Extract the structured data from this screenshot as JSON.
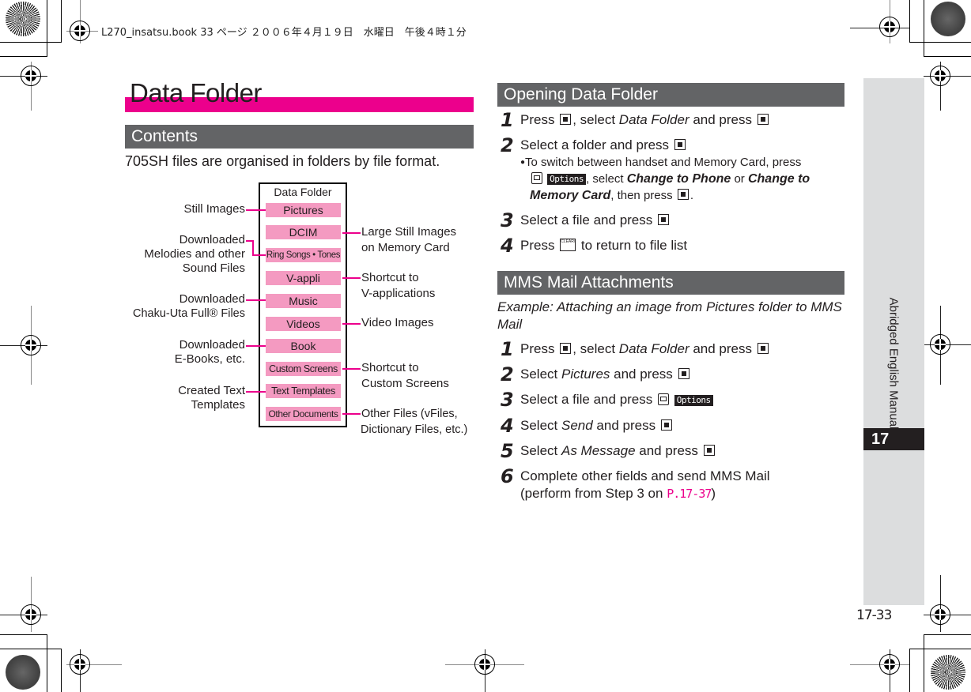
{
  "print_header": "L270_insatsu.book  33 ページ  ２００６年４月１９日　水曜日　午後４時１分",
  "page_title": "Data Folder",
  "contents": {
    "heading": "Contents",
    "intro": "705SH files are organised in folders by file format.",
    "diagram": {
      "box_title": "Data Folder",
      "folders": [
        "Pictures",
        "DCIM",
        "Ring Songs • Tones",
        "V-appli",
        "Music",
        "Videos",
        "Book",
        "Custom Screens",
        "Text Templates",
        "Other Documents"
      ],
      "left_labels": [
        {
          "lines": [
            "Still Images"
          ],
          "folder": "Pictures"
        },
        {
          "lines": [
            "Downloaded",
            "Melodies and other",
            "Sound Files"
          ],
          "folder": "Ring Songs • Tones"
        },
        {
          "lines": [
            "Downloaded",
            "Chaku-Uta Full® Files"
          ],
          "folder": "Music"
        },
        {
          "lines": [
            "Downloaded",
            "E-Books, etc."
          ],
          "folder": "Book"
        },
        {
          "lines": [
            "Created Text",
            "Templates"
          ],
          "folder": "Text Templates"
        }
      ],
      "right_labels": [
        {
          "lines": [
            "Large Still Images",
            "on Memory Card"
          ],
          "folder": "DCIM"
        },
        {
          "lines": [
            "Shortcut to",
            "V-applications"
          ],
          "folder": "V-appli"
        },
        {
          "lines": [
            "Video Images"
          ],
          "folder": "Videos"
        },
        {
          "lines": [
            "Shortcut to",
            "Custom Screens"
          ],
          "folder": "Custom Screens"
        },
        {
          "lines": [
            "Other Files (vFiles,",
            "Dictionary Files, etc.)"
          ],
          "folder": "Other Documents"
        }
      ]
    }
  },
  "opening": {
    "heading": "Opening Data Folder",
    "steps": [
      {
        "num": "1",
        "pre": "Press",
        "key1": "center",
        "mid": ", select ",
        "em": "Data Folder",
        "post": " and press",
        "key2": "center"
      },
      {
        "num": "2",
        "pre": "Select a folder and press",
        "key1": "center"
      },
      {
        "num": "3",
        "pre": "Select a file and press",
        "key1": "center"
      },
      {
        "num": "4",
        "pre": "Press",
        "key1": "clear-back",
        "post": " to return to file list"
      }
    ],
    "note": {
      "bullet": "●",
      "line1": "To switch between handset and Memory Card, press",
      "softkey": "Options",
      "sel": ", select ",
      "em1": "Change to Phone",
      "or": " or ",
      "em2a": "Change to",
      "em2b": "Memory Card",
      "tail": ", then press"
    }
  },
  "mms": {
    "heading": "MMS Mail Attachments",
    "example": "Example: Attaching an image from Pictures folder to MMS Mail",
    "steps": [
      {
        "num": "1",
        "pre": "Press",
        "mid": ", select ",
        "em": "Data Folder",
        "post": " and press"
      },
      {
        "num": "2",
        "pre": "Select ",
        "em": "Pictures",
        "post": " and press"
      },
      {
        "num": "3",
        "pre": "Select a file and press",
        "softkey": "Options"
      },
      {
        "num": "4",
        "pre": "Select ",
        "em": "Send",
        "post": " and press"
      },
      {
        "num": "5",
        "pre": "Select ",
        "em": "As Message",
        "post": " and press"
      },
      {
        "num": "6",
        "line1": "Complete other fields and send MMS Mail",
        "line2_pre": "(perform from Step 3 on ",
        "link": "P.17-37",
        "line2_post": ")"
      }
    ]
  },
  "side_tab": {
    "label": "Abridged English Manual",
    "chapter": "17"
  },
  "clear_key_text": "CLEAR/BACK",
  "page_number": "17-33",
  "colors": {
    "accent": "#ec008c",
    "section_bar": "#636466",
    "chip": "#f49ac1",
    "side_tab": "#dcddde"
  }
}
